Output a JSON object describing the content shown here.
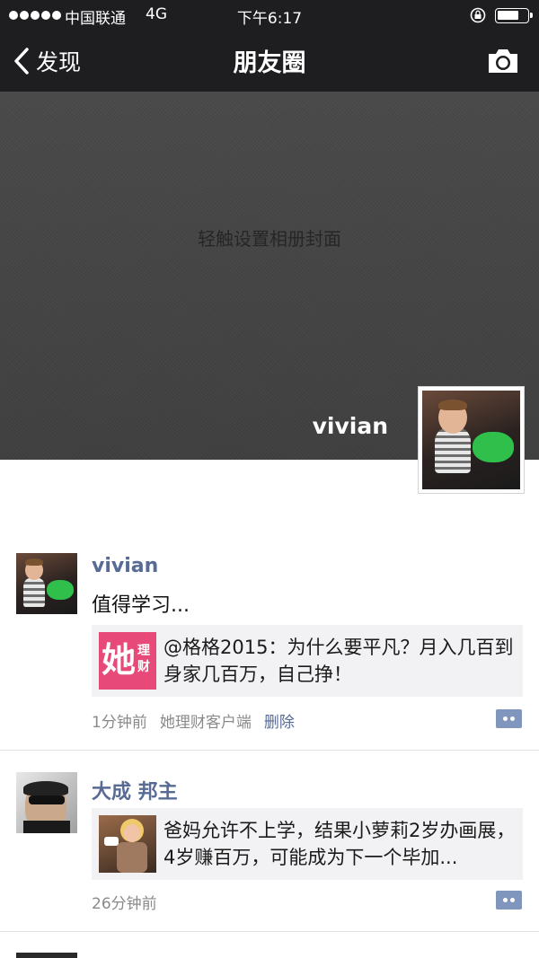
{
  "status_bar": {
    "carrier": "中国联通",
    "network": "4G",
    "time": "下午6:17",
    "battery_level": 0.75
  },
  "nav": {
    "back_label": "发现",
    "title": "朋友圈"
  },
  "cover": {
    "hint": "轻触设置相册封面",
    "profile_name": "vivian"
  },
  "posts": [
    {
      "author": "vivian",
      "text": "值得学习...",
      "share": {
        "logo_char_big": "她",
        "logo_chars_small": "理财",
        "title": "@格格2015：为什么要平凡？月入几百到身家几百万，自己挣！"
      },
      "time": "1分钟前",
      "source": "她理财客户端",
      "delete_label": "删除"
    },
    {
      "author": "大成 邦主",
      "share": {
        "title": "爸妈允许不上学，结果小萝莉2岁办画展，4岁赚百万，可能成为下一个毕加..."
      },
      "time": "26分钟前"
    }
  ],
  "colors": {
    "link": "#576b95",
    "navbar": "#1e1e20",
    "logo": "#e74a79"
  }
}
